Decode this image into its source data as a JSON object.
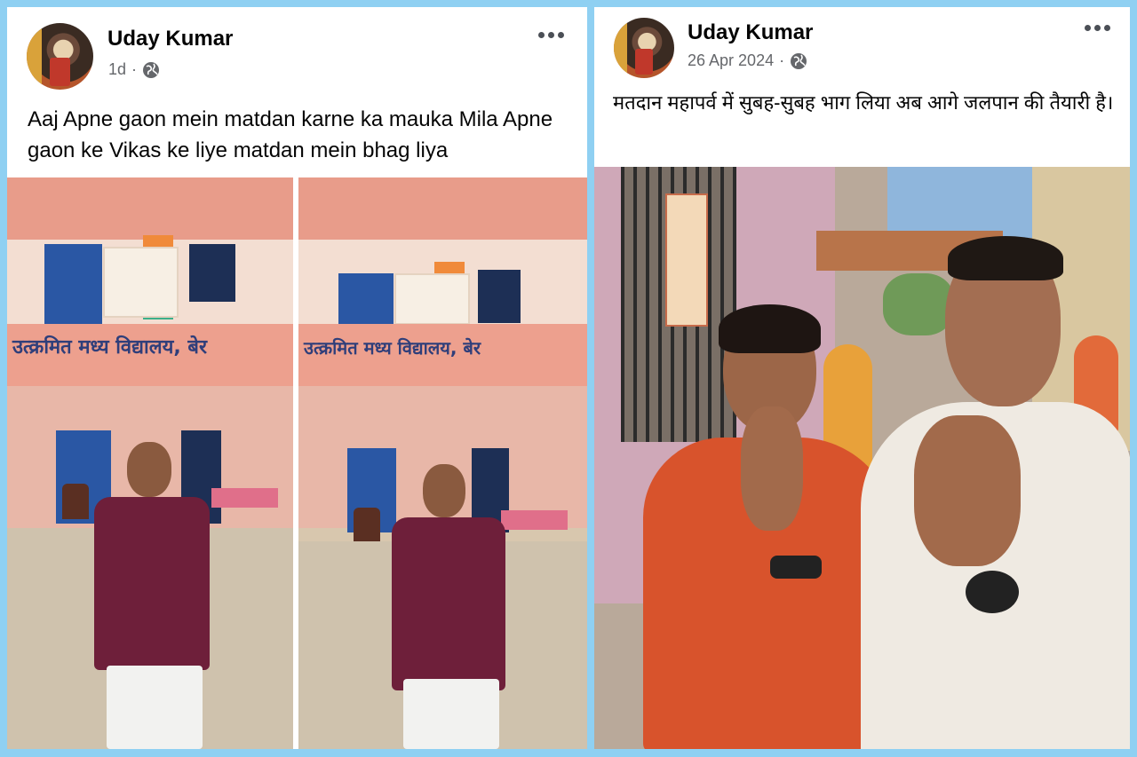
{
  "posts": [
    {
      "author": "Uday Kumar",
      "time": "1d",
      "separator": "·",
      "privacy_icon": "globe-icon",
      "menu_icon": "more-options-icon",
      "text": "Aaj Apne gaon mein matdan karne ka mauka Mila Apne gaon ke Vikas ke liye matdan mein bhag liya",
      "photos": [
        {
          "banner": "उत्क्रमित मध्य विद्यालय, बेर"
        },
        {
          "banner": "उत्क्रमित मध्य विद्यालय, बेर"
        }
      ]
    },
    {
      "author": "Uday Kumar",
      "time": "26 Apr 2024",
      "separator": "·",
      "privacy_icon": "globe-icon",
      "menu_icon": "more-options-icon",
      "text": "मतदान महापर्व में सुबह-सुबह भाग लिया अब आगे जलपान की तैयारी है।"
    }
  ],
  "colors": {
    "background": "#8fd0f2",
    "card": "#ffffff",
    "name": "#050505",
    "meta": "#65676b"
  }
}
